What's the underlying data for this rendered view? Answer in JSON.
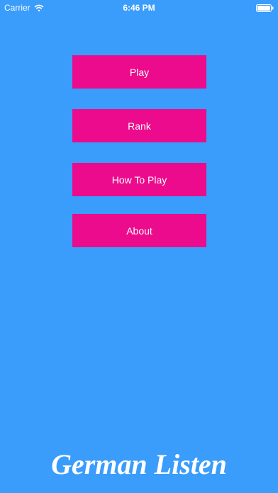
{
  "status_bar": {
    "carrier": "Carrier",
    "time": "6:46 PM",
    "wifi_icon": "wifi-icon",
    "battery_icon": "battery-icon"
  },
  "menu": {
    "play_label": "Play",
    "rank_label": "Rank",
    "how_to_play_label": "How To Play",
    "about_label": "About"
  },
  "app": {
    "title": "German Listen"
  },
  "colors": {
    "background": "#3a9cfb",
    "button": "#ec0b8c",
    "text": "#ffffff"
  }
}
